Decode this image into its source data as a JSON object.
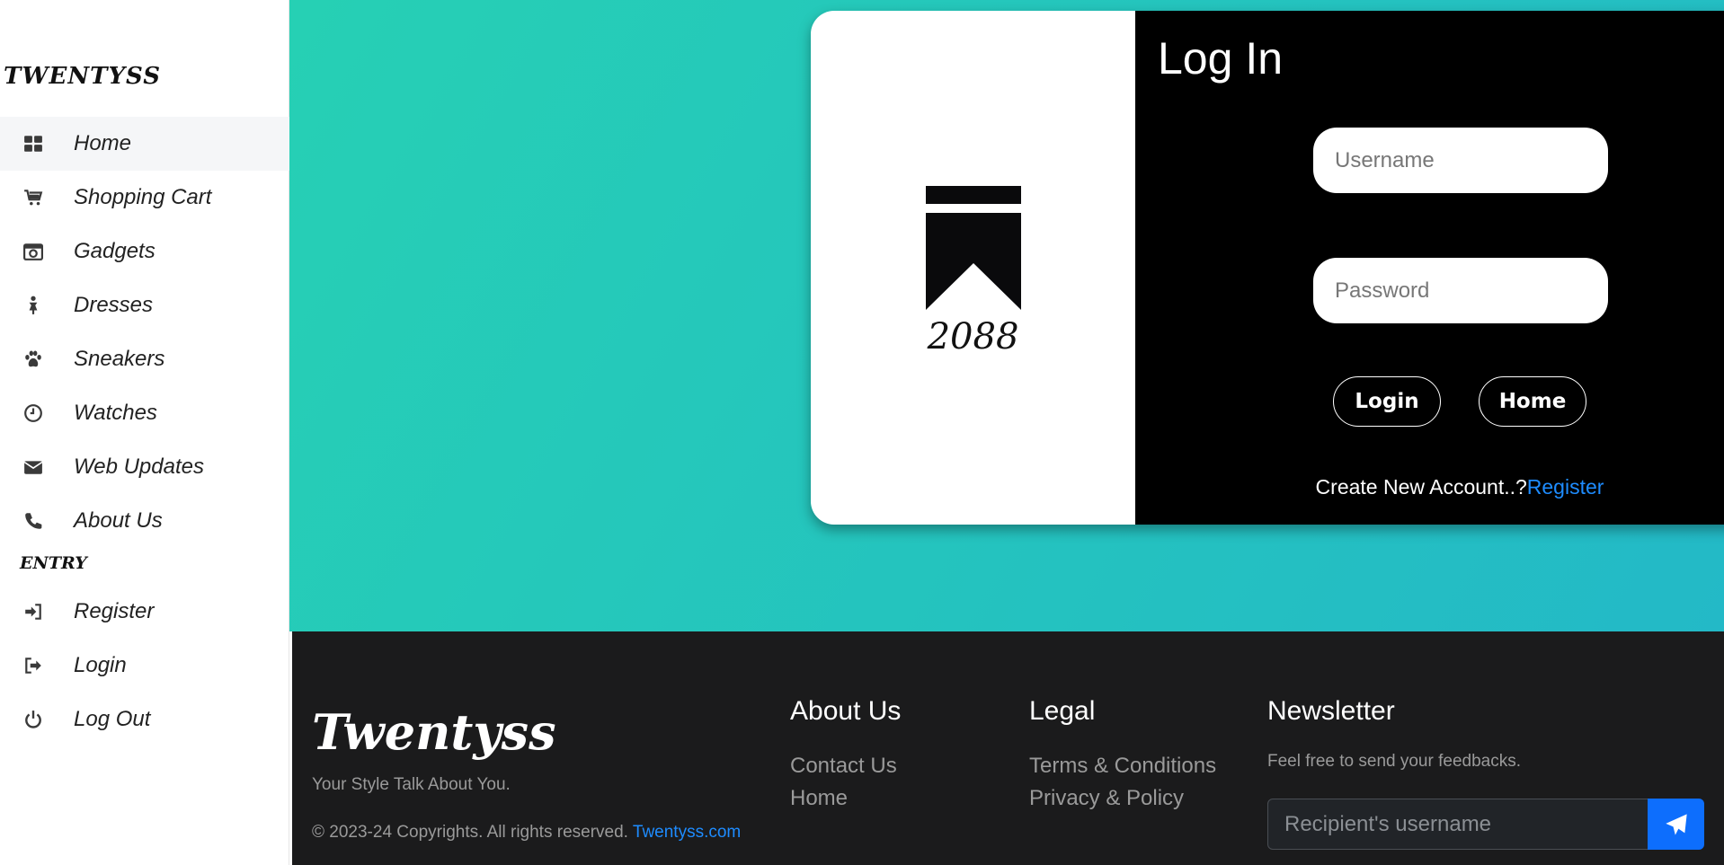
{
  "sidebar": {
    "brand": "TWENTYSS",
    "items": [
      {
        "label": "Home",
        "icon": "dashboard-icon"
      },
      {
        "label": "Shopping Cart",
        "icon": "cart-icon"
      },
      {
        "label": "Gadgets",
        "icon": "camera-icon"
      },
      {
        "label": "Dresses",
        "icon": "female-icon"
      },
      {
        "label": "Sneakers",
        "icon": "paw-icon"
      },
      {
        "label": "Watches",
        "icon": "clock-icon"
      },
      {
        "label": "Web Updates",
        "icon": "envelope-icon"
      },
      {
        "label": "About Us",
        "icon": "phone-icon"
      }
    ],
    "section_label": "ENTRY",
    "entry_items": [
      {
        "label": "Register",
        "icon": "sign-in-icon"
      },
      {
        "label": "Login",
        "icon": "sign-out-icon"
      },
      {
        "label": "Log Out",
        "icon": "power-icon"
      }
    ]
  },
  "login": {
    "logo_text": "2088",
    "title": "Log In",
    "username_placeholder": "Username",
    "password_placeholder": "Password",
    "login_button": "Login",
    "home_button": "Home",
    "create_text": "Create New Account..?",
    "register_link": "Register"
  },
  "footer": {
    "brand": "Twentyss",
    "tagline": "Your Style Talk About You.",
    "copyright": "© 2023-24 Copyrights. All rights reserved. ",
    "copyright_link": "Twentyss.com",
    "about_title": "About Us",
    "about_links": [
      "Contact Us",
      "Home"
    ],
    "legal_title": "Legal",
    "legal_links": [
      "Terms & Conditions",
      "Privacy & Policy"
    ],
    "newsletter_title": "Newsletter",
    "newsletter_desc": "Feel free to send your feedbacks.",
    "newsletter_placeholder": "Recipient's username",
    "send_icon": "paper-plane-icon"
  },
  "colors": {
    "gradient_start": "#26d0b4",
    "gradient_end": "#23b9c7",
    "link_blue": "#1e8cff",
    "footer_bg": "#1b1b1c",
    "send_button": "#0d6efd"
  }
}
